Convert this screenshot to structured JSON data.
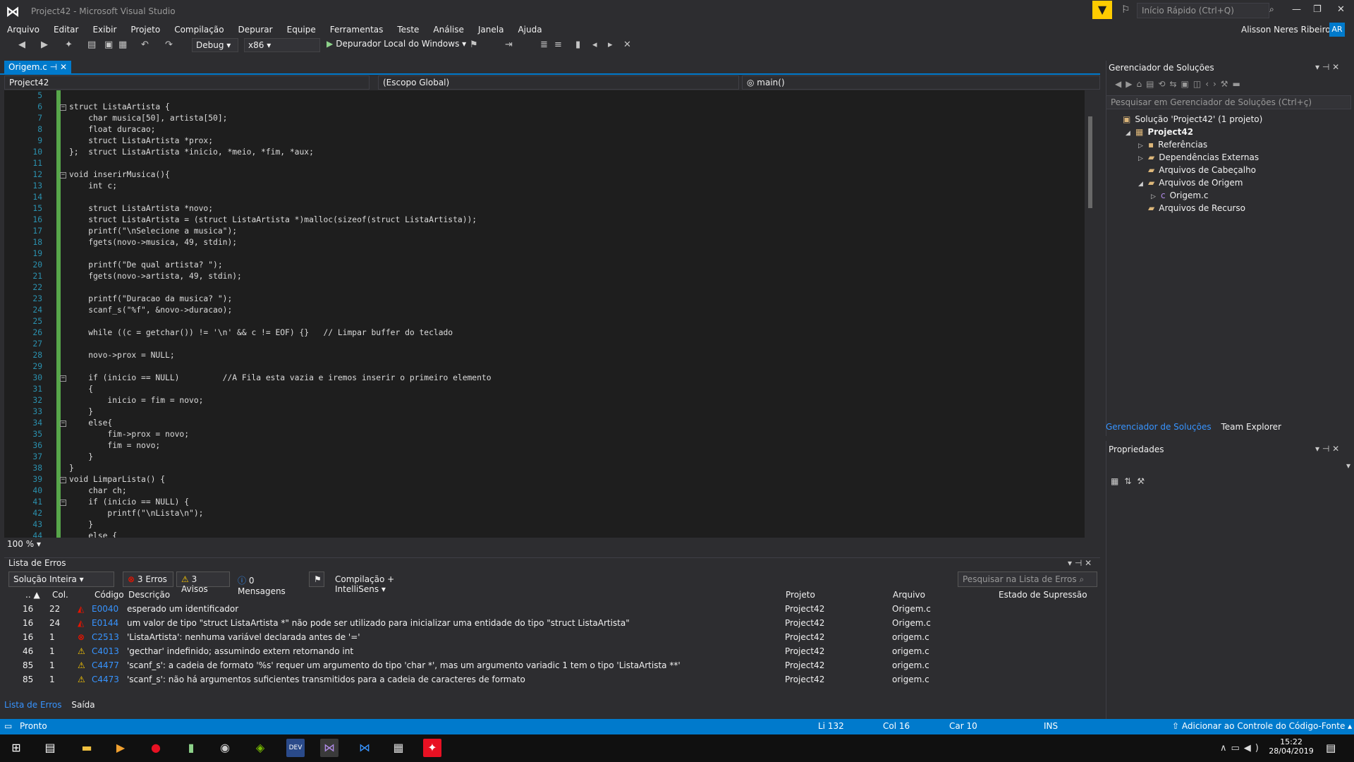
{
  "window": {
    "title": "Project42 - Microsoft Visual Studio",
    "quick_launch_placeholder": "Início Rápido (Ctrl+Q)",
    "user_name": "Alisson Neres Ribeiro",
    "user_initials": "AR"
  },
  "menu": [
    "Arquivo",
    "Editar",
    "Exibir",
    "Projeto",
    "Compilação",
    "Depurar",
    "Equipe",
    "Ferramentas",
    "Teste",
    "Análise",
    "Janela",
    "Ajuda"
  ],
  "toolbar": {
    "config": "Debug",
    "platform": "x86",
    "debugger": "Depurador Local do Windows"
  },
  "editor": {
    "tab_label": "Origem.c",
    "nav_project": "Project42",
    "nav_scope": "(Escopo Global)",
    "nav_member": "main()",
    "zoom": "100 %",
    "lines": [
      {
        "n": "5",
        "text": ""
      },
      {
        "n": "6",
        "text": "struct ListaArtista {"
      },
      {
        "n": "7",
        "text": "    char musica[50], artista[50];"
      },
      {
        "n": "8",
        "text": "    float duracao;"
      },
      {
        "n": "9",
        "text": "    struct ListaArtista *prox;"
      },
      {
        "n": "10",
        "text": "};  struct ListaArtista *inicio, *meio, *fim, *aux;"
      },
      {
        "n": "11",
        "text": ""
      },
      {
        "n": "12",
        "text": "void inserirMusica(){"
      },
      {
        "n": "13",
        "text": "    int c;"
      },
      {
        "n": "14",
        "text": ""
      },
      {
        "n": "15",
        "text": "    struct ListaArtista *novo;"
      },
      {
        "n": "16",
        "text": "    struct ListaArtista = (struct ListaArtista *)malloc(sizeof(struct ListaArtista));"
      },
      {
        "n": "17",
        "text": "    printf(\"\\nSelecione a musica\");"
      },
      {
        "n": "18",
        "text": "    fgets(novo->musica, 49, stdin);"
      },
      {
        "n": "19",
        "text": ""
      },
      {
        "n": "20",
        "text": "    printf(\"De qual artista? \");"
      },
      {
        "n": "21",
        "text": "    fgets(novo->artista, 49, stdin);"
      },
      {
        "n": "22",
        "text": ""
      },
      {
        "n": "23",
        "text": "    printf(\"Duracao da musica? \");"
      },
      {
        "n": "24",
        "text": "    scanf_s(\"%f\", &novo->duracao);"
      },
      {
        "n": "25",
        "text": ""
      },
      {
        "n": "26",
        "text": "    while ((c = getchar()) != '\\n' && c != EOF) {}   // Limpar buffer do teclado"
      },
      {
        "n": "27",
        "text": ""
      },
      {
        "n": "28",
        "text": "    novo->prox = NULL;"
      },
      {
        "n": "29",
        "text": ""
      },
      {
        "n": "30",
        "text": "    if (inicio == NULL)         //A Fila esta vazia e iremos inserir o primeiro elemento"
      },
      {
        "n": "31",
        "text": "    {"
      },
      {
        "n": "32",
        "text": "        inicio = fim = novo;"
      },
      {
        "n": "33",
        "text": "    }"
      },
      {
        "n": "34",
        "text": "    else{"
      },
      {
        "n": "35",
        "text": "        fim->prox = novo;"
      },
      {
        "n": "36",
        "text": "        fim = novo;"
      },
      {
        "n": "37",
        "text": "    }"
      },
      {
        "n": "38",
        "text": "}"
      },
      {
        "n": "39",
        "text": "void LimparLista() {"
      },
      {
        "n": "40",
        "text": "    char ch;"
      },
      {
        "n": "41",
        "text": "    if (inicio == NULL) {"
      },
      {
        "n": "42",
        "text": "        printf(\"\\nLista\\n\");"
      },
      {
        "n": "43",
        "text": "    }"
      },
      {
        "n": "44",
        "text": "    else {"
      }
    ]
  },
  "error_list": {
    "title": "Lista de Erros",
    "scope": "Solução Inteira",
    "errors_btn": "3 Erros",
    "warnings_btn": "3 Avisos",
    "messages_btn": "0 Mensagens",
    "build_filter": "Compilação + IntelliSens",
    "search_placeholder": "Pesquisar na Lista de Erros",
    "columns": [
      "..",
      "Col.",
      "Código",
      "Descrição",
      "Projeto",
      "Arquivo",
      "Estado de Supressão"
    ],
    "rows": [
      {
        "line": "16",
        "col": "22",
        "kind": "intellisense",
        "code": "E0040",
        "desc": "esperado um identificador",
        "project": "Project42",
        "file": "Origem.c"
      },
      {
        "line": "16",
        "col": "24",
        "kind": "intellisense",
        "code": "E0144",
        "desc": "um valor de tipo \"struct ListaArtista *\" não pode ser utilizado para inicializar uma entidade do tipo \"struct ListaArtista\"",
        "project": "Project42",
        "file": "Origem.c"
      },
      {
        "line": "16",
        "col": "1",
        "kind": "error",
        "code": "C2513",
        "desc": "'ListaArtista': nenhuma variável declarada antes de '='",
        "project": "Project42",
        "file": "origem.c"
      },
      {
        "line": "46",
        "col": "1",
        "kind": "warning",
        "code": "C4013",
        "desc": "'gecthar' indefinido; assumindo extern retornando int",
        "project": "Project42",
        "file": "origem.c"
      },
      {
        "line": "85",
        "col": "1",
        "kind": "warning",
        "code": "C4477",
        "desc": "'scanf_s': a cadeia de formato '%s' requer um argumento do tipo 'char *', mas um argumento variadic 1 tem o tipo 'ListaArtista **'",
        "project": "Project42",
        "file": "origem.c"
      },
      {
        "line": "85",
        "col": "1",
        "kind": "warning",
        "code": "C4473",
        "desc": "'scanf_s': não há argumentos suficientes transmitidos para a cadeia de caracteres de formato",
        "project": "Project42",
        "file": "origem.c"
      }
    ],
    "bottom_tabs": [
      "Lista de Erros",
      "Saída"
    ]
  },
  "solution_explorer": {
    "title": "Gerenciador de Soluções",
    "search_placeholder": "Pesquisar em Gerenciador de Soluções (Ctrl+ç)",
    "tree": [
      {
        "label": "Solução 'Project42' (1 projeto)",
        "depth": 0,
        "icon": "solution-icon"
      },
      {
        "label": "Project42",
        "depth": 1,
        "icon": "project-icon"
      },
      {
        "label": "Referências",
        "depth": 2,
        "icon": "references-icon"
      },
      {
        "label": "Dependências Externas",
        "depth": 2,
        "icon": "folder-icon"
      },
      {
        "label": "Arquivos de Cabeçalho",
        "depth": 2,
        "icon": "folder-icon"
      },
      {
        "label": "Arquivos de Origem",
        "depth": 2,
        "icon": "folder-icon"
      },
      {
        "label": "Origem.c",
        "depth": 3,
        "icon": "c-file-icon"
      },
      {
        "label": "Arquivos de Recurso",
        "depth": 2,
        "icon": "folder-icon"
      }
    ],
    "tabs": [
      "Gerenciador de Soluções",
      "Team Explorer"
    ]
  },
  "properties": {
    "title": "Propriedades"
  },
  "status": {
    "ready": "Pronto",
    "line": "Li 132",
    "col": "Col 16",
    "char": "Car 10",
    "mode": "INS",
    "source_control": "Adicionar ao Controle do Código-Fonte"
  },
  "taskbar": {
    "time": "15:22",
    "date": "28/04/2019"
  }
}
